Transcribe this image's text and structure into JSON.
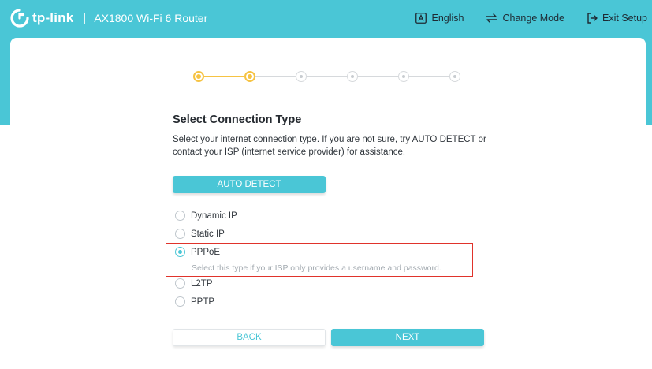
{
  "header": {
    "brand": "tp-link",
    "separator": "|",
    "product": "AX1800 Wi-Fi 6 Router",
    "actions": [
      {
        "label": "English",
        "icon": "language-icon"
      },
      {
        "label": "Change Mode",
        "icon": "change-mode-icon"
      },
      {
        "label": "Exit Setup",
        "icon": "exit-icon"
      }
    ]
  },
  "stepper": {
    "total_steps": 6,
    "current_step": 2,
    "active_color": "#f6c343",
    "inactive_color": "#d6d9dc"
  },
  "content": {
    "title": "Select Connection Type",
    "description": "Select your internet connection type. If you are not sure, try AUTO DETECT or contact your ISP (internet service provider) for assistance.",
    "auto_detect_label": "AUTO DETECT",
    "options": [
      {
        "label": "Dynamic IP",
        "checked": false
      },
      {
        "label": "Static IP",
        "checked": false
      },
      {
        "label": "PPPoE",
        "checked": true
      },
      {
        "label": "L2TP",
        "checked": false
      },
      {
        "label": "PPTP",
        "checked": false
      }
    ],
    "pppoe_hint": "Select this type if your ISP only provides a username and password."
  },
  "footer": {
    "back_label": "BACK",
    "next_label": "NEXT"
  },
  "colors": {
    "brand": "#4ac6d6",
    "highlight_box": "#e0332b"
  }
}
